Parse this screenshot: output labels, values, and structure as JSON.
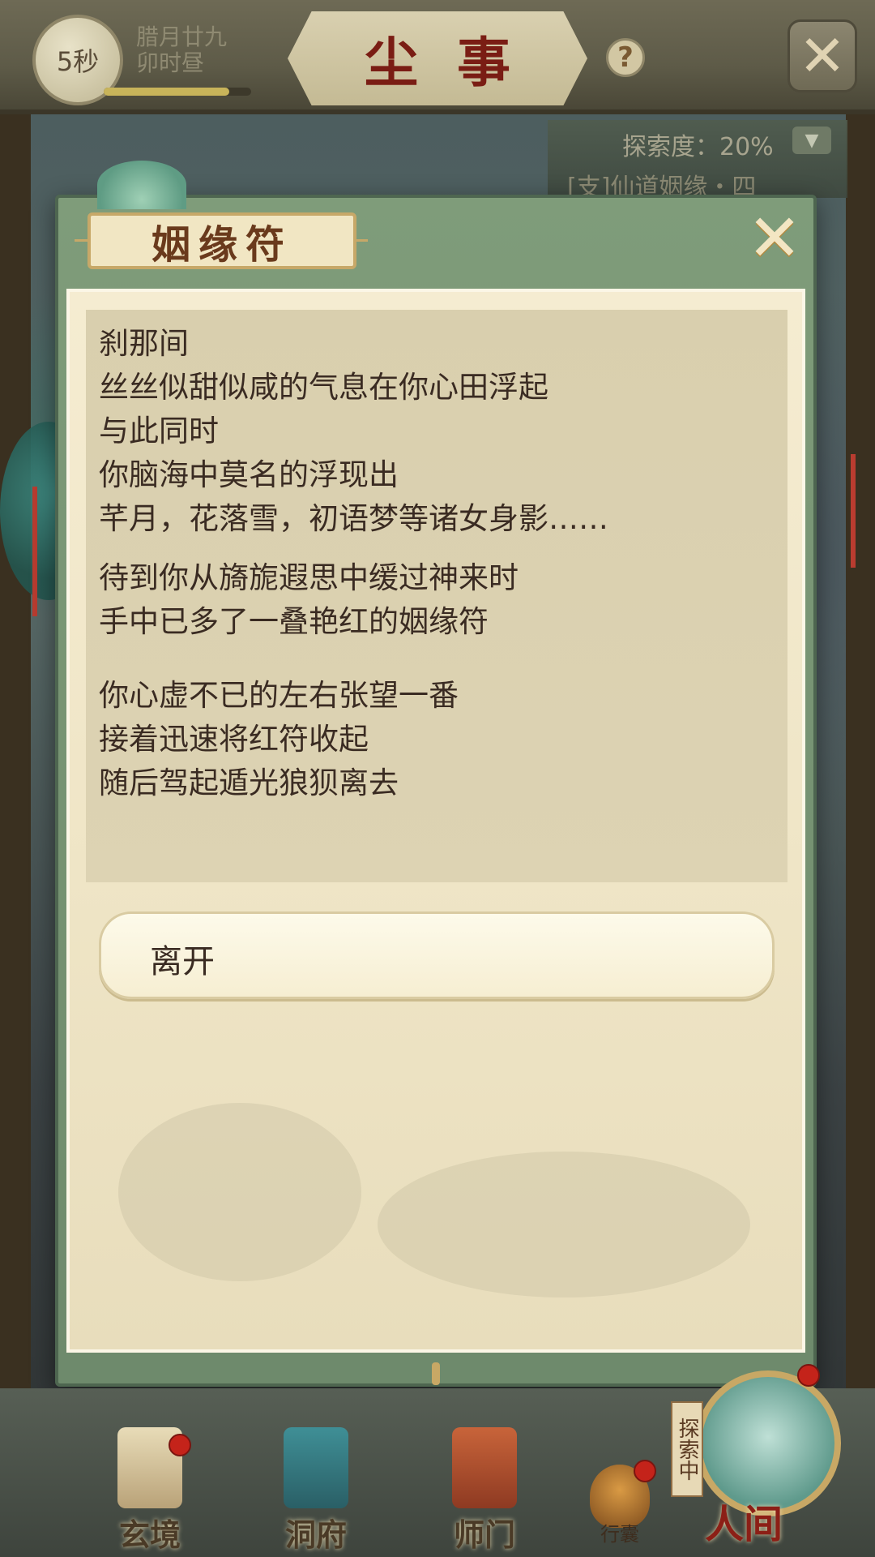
{
  "header": {
    "timer": "5秒",
    "date_line1": "腊月廿九",
    "date_line2": "卯时昼",
    "time_progress": 0.85,
    "title": "尘事",
    "help_icon": "question-icon",
    "close_icon": "close-icon"
  },
  "exploration": {
    "degree": "探索度：20%",
    "quest": "[支]仙道姻缘・四",
    "toggle_icon": "chevron-down-icon"
  },
  "dialog": {
    "title": "姻缘符",
    "close_icon": "close-icon",
    "story_lines": [
      "刹那间",
      "丝丝似甜似咸的气息在你心田浮起",
      "与此同时",
      "你脑海中莫名的浮现出",
      "芊月，花落雪，初语梦等诸女身影……",
      "待到你从旖旎遐思中缓过神来时",
      "手中已多了一叠艳红的姻缘符",
      "你心虚不已的左右张望一番",
      "接着迅速将红符收起",
      "随后驾起遁光狼狈离去"
    ],
    "option": "离开"
  },
  "bottom_nav": {
    "items": [
      {
        "label": "玄境",
        "icon": "scroll-icon",
        "badge": true
      },
      {
        "label": "洞府",
        "icon": "pavilion-icon",
        "badge": false
      },
      {
        "label": "师门",
        "icon": "banner-icon",
        "badge": false
      }
    ],
    "bag_label": "行囊",
    "human_world": "人间",
    "exploring_tag": "探索中"
  },
  "colors": {
    "accent_red": "#7a1d14",
    "panel_green": "#7f9c7a",
    "paper": "#f5ecd1",
    "text": "#3a2b22"
  }
}
